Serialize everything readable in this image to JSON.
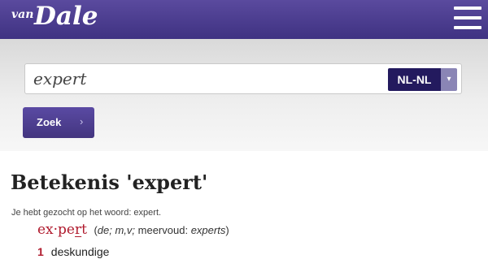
{
  "header": {
    "logo_van": "van",
    "logo_dale": "Dale",
    "menu_icon": "hamburger-menu-icon",
    "background_color": "#4a3c8e"
  },
  "search": {
    "value": "expert",
    "language": "NL-NL",
    "dropdown_icon": "chevron-down-icon",
    "button_label": "Zoek",
    "button_arrow": "›"
  },
  "result": {
    "title": "Betekenis 'expert'",
    "searched_note": "Je hebt gezocht op het woord: expert.",
    "headword_pre": "ex·pe",
    "headword_stress": "r",
    "headword_post": "t",
    "grammar_open": "(",
    "grammar_italic": "de; m,v;",
    "grammar_mid": " meervoud: ",
    "grammar_plural": "experts",
    "grammar_close": ")",
    "senses": [
      {
        "number": "1",
        "text": "deskundige"
      }
    ]
  },
  "colors": {
    "brand_purple": "#4a3c8e",
    "dark_navy": "#231a5e",
    "headword_red": "#b01b2e"
  }
}
